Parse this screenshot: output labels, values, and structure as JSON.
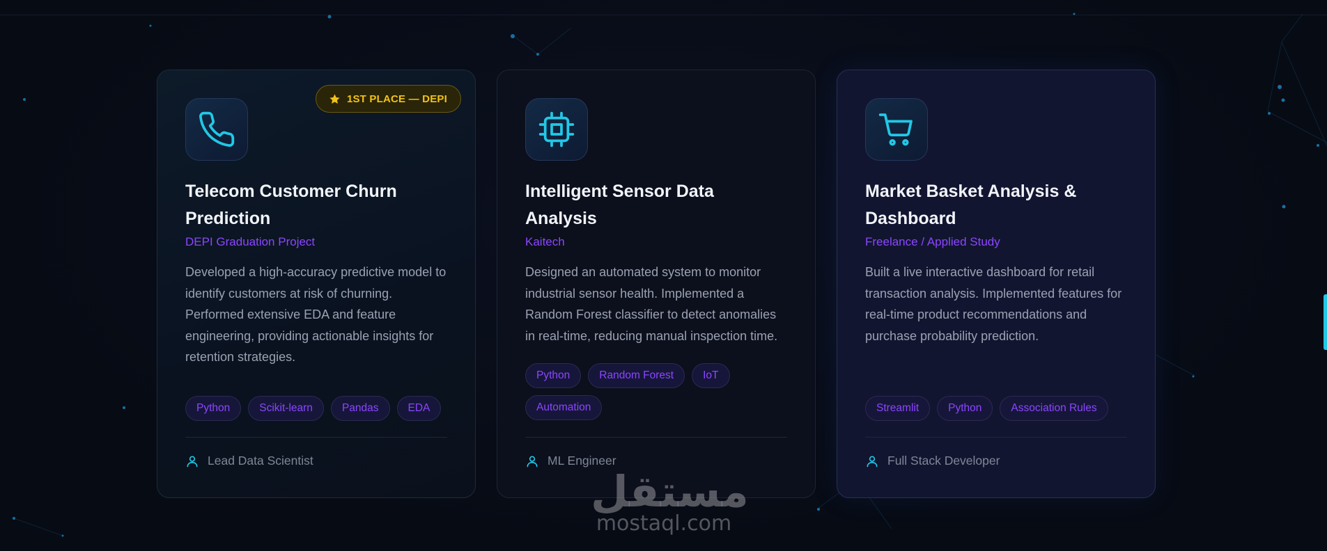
{
  "colors": {
    "accent_cyan": "#22c8e6",
    "accent_purple": "#8b46ff",
    "badge_gold": "#f1c21b",
    "background": "#070b14"
  },
  "projects": [
    {
      "icon": "phone-icon",
      "badge": "1ST PLACE — DEPI",
      "title": "Telecom Customer Churn Prediction",
      "org": "DEPI Graduation Project",
      "description": "Developed a high-accuracy predictive model to identify customers at risk of churning. Performed extensive EDA and feature engineering, providing actionable insights for retention strategies.",
      "tags": [
        "Python",
        "Scikit-learn",
        "Pandas",
        "EDA"
      ],
      "role": "Lead Data Scientist"
    },
    {
      "icon": "cpu-chip-icon",
      "title": "Intelligent Sensor Data Analysis",
      "org": "Kaitech",
      "description": "Designed an automated system to monitor industrial sensor health. Implemented a Random Forest classifier to detect anomalies in real-time, reducing manual inspection time.",
      "tags": [
        "Python",
        "Random Forest",
        "IoT",
        "Automation"
      ],
      "role": "ML Engineer"
    },
    {
      "icon": "shopping-cart-icon",
      "title": "Market Basket Analysis & Dashboard",
      "org": "Freelance / Applied Study",
      "description": "Built a live interactive dashboard for retail transaction analysis. Implemented features for real-time product recommendations and purchase probability prediction.",
      "tags": [
        "Streamlit",
        "Python",
        "Association Rules"
      ],
      "role": "Full Stack Developer"
    }
  ],
  "watermark": {
    "arabic": "مستقل",
    "latin": "mostaql.com"
  }
}
